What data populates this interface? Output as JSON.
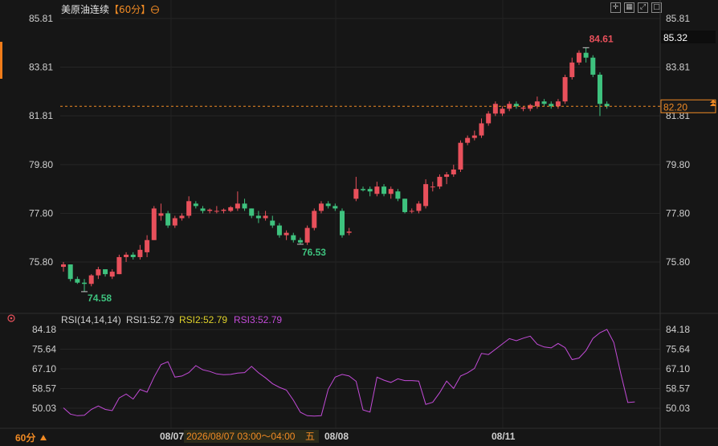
{
  "header": {
    "title": "美原油连续",
    "period": "【60分】",
    "rsi_label": "RSI(14,14,14)",
    "rsi1": "RSI1:52.79",
    "rsi2": "RSI2:52.79",
    "rsi3": "RSI3:52.79"
  },
  "footer": {
    "period": "60分",
    "dates": [
      "08/07",
      "08/08",
      "08/11"
    ],
    "crosshair_time": "2026/08/07 03:00～04:00",
    "crosshair_weekday": "五"
  },
  "colors": {
    "up": "#e8505b",
    "down": "#3ec27e",
    "accent": "#f08a24",
    "rsi": "#c34bd8"
  },
  "chart_data": [
    {
      "type": "candlestick",
      "ylim": [
        74.58,
        86.0
      ],
      "yticks": [
        "85.81",
        "83.81",
        "81.81",
        "79.80",
        "77.80",
        "75.80"
      ],
      "last_price": "82.20",
      "last_price_value": 82.2,
      "marker_price": "85.32",
      "high_label": "84.61",
      "high_value": 84.61,
      "low_label": "74.58",
      "low_value": 74.58,
      "mid_low_label": "76.53",
      "mid_low_value": 76.53,
      "candles": [
        [
          75.6,
          75.8,
          75.4,
          75.7
        ],
        [
          75.7,
          75.7,
          75.0,
          75.1
        ],
        [
          75.1,
          75.2,
          74.9,
          74.95
        ],
        [
          74.95,
          75.1,
          74.58,
          74.9
        ],
        [
          74.9,
          75.3,
          74.8,
          75.25
        ],
        [
          75.25,
          75.6,
          75.1,
          75.5
        ],
        [
          75.5,
          75.5,
          75.2,
          75.3
        ],
        [
          75.2,
          75.5,
          75.1,
          75.4
        ],
        [
          75.3,
          76.1,
          75.3,
          76.0
        ],
        [
          76.0,
          76.2,
          75.8,
          76.1
        ],
        [
          76.1,
          76.2,
          75.9,
          76.0
        ],
        [
          76.0,
          76.5,
          75.9,
          76.3
        ],
        [
          76.2,
          76.9,
          76.0,
          76.7
        ],
        [
          76.7,
          78.1,
          76.7,
          78.0
        ],
        [
          77.7,
          78.2,
          77.5,
          77.8
        ],
        [
          77.8,
          77.9,
          77.2,
          77.3
        ],
        [
          77.3,
          77.7,
          77.2,
          77.6
        ],
        [
          77.6,
          77.8,
          77.5,
          77.7
        ],
        [
          77.7,
          78.5,
          77.6,
          78.3
        ],
        [
          78.2,
          78.3,
          78.0,
          78.1
        ],
        [
          78.0,
          78.1,
          77.8,
          77.9
        ],
        [
          77.9,
          78.0,
          77.8,
          77.95
        ],
        [
          77.9,
          78.1,
          77.8,
          77.9
        ],
        [
          77.9,
          78.0,
          77.8,
          77.95
        ],
        [
          77.9,
          78.1,
          77.85,
          78.05
        ],
        [
          78.0,
          78.7,
          77.9,
          78.2
        ],
        [
          78.2,
          78.4,
          77.9,
          78.0
        ],
        [
          78.0,
          78.0,
          77.6,
          77.7
        ],
        [
          77.7,
          77.9,
          77.4,
          77.6
        ],
        [
          77.6,
          77.9,
          77.5,
          77.7
        ],
        [
          77.5,
          77.7,
          77.2,
          77.3
        ],
        [
          77.3,
          77.4,
          76.8,
          76.9
        ],
        [
          76.9,
          77.1,
          76.7,
          77.0
        ],
        [
          76.9,
          77.0,
          76.6,
          76.7
        ],
        [
          76.7,
          76.8,
          76.53,
          76.6
        ],
        [
          76.6,
          77.3,
          76.5,
          77.2
        ],
        [
          77.2,
          78.0,
          77.1,
          77.9
        ],
        [
          77.9,
          78.3,
          77.8,
          78.2
        ],
        [
          78.2,
          78.3,
          78.0,
          78.1
        ],
        [
          78.1,
          78.2,
          77.9,
          78.0
        ],
        [
          77.9,
          78.0,
          76.8,
          76.9
        ],
        [
          77.0,
          77.2,
          76.9,
          77.05
        ],
        [
          78.4,
          79.3,
          78.3,
          78.8
        ],
        [
          78.8,
          78.9,
          78.7,
          78.75
        ],
        [
          78.8,
          78.9,
          78.5,
          78.7
        ],
        [
          78.6,
          79.1,
          78.5,
          78.9
        ],
        [
          78.9,
          79.0,
          78.5,
          78.6
        ],
        [
          78.6,
          78.9,
          78.4,
          78.8
        ],
        [
          78.7,
          78.8,
          78.3,
          78.4
        ],
        [
          78.4,
          78.4,
          77.8,
          77.85
        ],
        [
          77.9,
          78.0,
          77.8,
          77.9
        ],
        [
          77.9,
          78.3,
          77.8,
          78.2
        ],
        [
          78.1,
          79.2,
          78.0,
          79.0
        ],
        [
          78.9,
          79.1,
          78.7,
          78.9
        ],
        [
          78.9,
          79.4,
          78.8,
          79.3
        ],
        [
          79.3,
          79.5,
          79.0,
          79.4
        ],
        [
          79.4,
          79.8,
          79.3,
          79.6
        ],
        [
          79.6,
          80.8,
          79.5,
          80.7
        ],
        [
          80.7,
          81.0,
          80.6,
          80.9
        ],
        [
          80.9,
          81.2,
          80.8,
          81.0
        ],
        [
          81.0,
          81.7,
          80.9,
          81.5
        ],
        [
          81.5,
          82.0,
          81.4,
          81.9
        ],
        [
          81.9,
          82.4,
          81.8,
          82.3
        ],
        [
          81.9,
          82.2,
          81.8,
          82.1
        ],
        [
          82.1,
          82.4,
          82.0,
          82.3
        ],
        [
          82.3,
          82.4,
          82.1,
          82.2
        ],
        [
          82.1,
          82.2,
          82.0,
          82.15
        ],
        [
          82.1,
          82.3,
          82.0,
          82.25
        ],
        [
          82.2,
          82.6,
          82.1,
          82.4
        ],
        [
          82.4,
          82.5,
          82.2,
          82.3
        ],
        [
          82.3,
          82.4,
          82.1,
          82.2
        ],
        [
          82.2,
          82.5,
          82.1,
          82.4
        ],
        [
          82.4,
          83.5,
          82.3,
          83.4
        ],
        [
          83.4,
          84.2,
          83.3,
          84.0
        ],
        [
          84.0,
          84.5,
          83.9,
          84.4
        ],
        [
          84.4,
          84.61,
          84.0,
          84.2
        ],
        [
          84.2,
          84.3,
          83.4,
          83.5
        ],
        [
          83.5,
          83.6,
          81.8,
          82.3
        ],
        [
          82.3,
          82.4,
          82.1,
          82.2
        ]
      ]
    },
    {
      "type": "line",
      "name": "RSI",
      "ylim": [
        46.0,
        86.5
      ],
      "yticks": [
        "84.18",
        "75.64",
        "67.10",
        "58.57",
        "50.03"
      ],
      "values": [
        50.2,
        47.5,
        46.8,
        47.0,
        49.5,
        51.0,
        49.5,
        49.0,
        54.5,
        56.2,
        54.0,
        58.2,
        57.0,
        63.5,
        69.0,
        70.2,
        63.5,
        64.0,
        65.5,
        68.5,
        66.7,
        66.0,
        64.9,
        64.6,
        64.7,
        65.3,
        65.5,
        68.2,
        65.4,
        63.2,
        60.7,
        59.1,
        57.9,
        53.5,
        48.3,
        46.8,
        46.6,
        46.8,
        58.3,
        63.5,
        64.7,
        64.0,
        61.7,
        49.3,
        48.4,
        63.5,
        62.2,
        61.2,
        62.8,
        62.0,
        62.0,
        61.8,
        51.7,
        52.6,
        56.8,
        61.8,
        58.6,
        64.0,
        65.4,
        67.3,
        73.8,
        73.3,
        75.6,
        77.9,
        80.2,
        79.3,
        80.4,
        81.3,
        77.8,
        76.6,
        76.2,
        78.1,
        76.3,
        71.1,
        71.8,
        75.0,
        80.3,
        82.8,
        84.2,
        78.5,
        65.0,
        52.5,
        52.8
      ]
    }
  ]
}
